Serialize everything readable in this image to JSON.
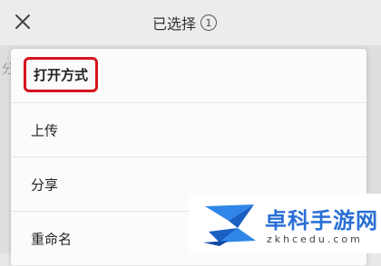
{
  "header": {
    "title": "已选择",
    "selected_count": "1"
  },
  "background": {
    "partial_glyph": "分"
  },
  "menu": {
    "items": [
      {
        "label": "打开方式",
        "highlighted": true
      },
      {
        "label": "上传"
      },
      {
        "label": "分享"
      },
      {
        "label": "重命名"
      }
    ]
  },
  "watermark": {
    "name": "卓科手游网",
    "url": "zkhcedu.com"
  },
  "colors": {
    "highlight_border": "#d3141c",
    "watermark_blue": "#2a6fd6"
  }
}
